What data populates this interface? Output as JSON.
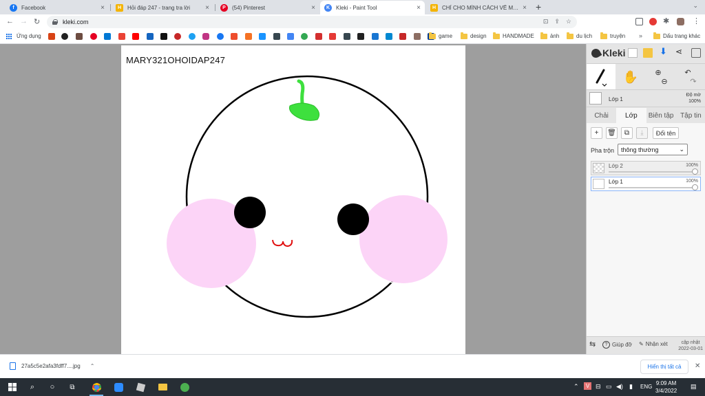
{
  "browser": {
    "tabs": [
      {
        "title": "Facebook",
        "icon_color": "#1877f2",
        "icon_glyph": "f",
        "active": false
      },
      {
        "title": "Hỏi đáp 247 - trang tra lời",
        "icon_color": "#f4b400",
        "icon_glyph": "H",
        "active": false
      },
      {
        "title": "(54) Pinterest",
        "icon_color": "#e60023",
        "icon_glyph": "P",
        "active": false
      },
      {
        "title": "Kleki - Paint Tool",
        "icon_color": "#4285f4",
        "icon_glyph": "K",
        "active": true
      },
      {
        "title": "CHỈ CHO MÌNH CÁCH VẼ MẦM Đ",
        "icon_color": "#f4b400",
        "icon_glyph": "H",
        "active": false
      }
    ],
    "new_tab_glyph": "+",
    "address": "kleki.com"
  },
  "bookmarks": {
    "apps_label": "Ứng dụng",
    "folders": [
      "game",
      "design",
      "HANDMADE",
      "ảnh",
      "du lịch",
      "truyện"
    ],
    "more_glyph": "»",
    "other_label": "Dấu trang khác"
  },
  "canvas": {
    "text": "MARY321OHOIDAP247"
  },
  "kleki": {
    "logo": "Kleki",
    "top_layer_name": "Lớp 1",
    "top_opacity_label": "Độ mờ",
    "top_opacity_value": "100%",
    "tabs": [
      "Chải",
      "Lớp",
      "Biên tập",
      "Tập tin"
    ],
    "active_tab": "Lớp",
    "rename_label": "Đổi tên",
    "blend_label": "Pha trộn",
    "blend_value": "thông thường",
    "layers": [
      {
        "name": "Lớp 2",
        "opacity": "100%",
        "selected": false
      },
      {
        "name": "Lớp 1",
        "opacity": "100%",
        "selected": true
      }
    ],
    "footer": {
      "help_label": "Giúp đỡ",
      "feedback_label": "Nhận xét",
      "update_label": "cập nhật",
      "update_date": "2022-03-01"
    }
  },
  "download": {
    "filename": "27a5c5e2afa3fdff7....jpg",
    "show_all": "Hiển thị tất cả"
  },
  "taskbar": {
    "language": "ENG",
    "time": "9:09 AM",
    "date": "3/4/2022"
  },
  "colors": {
    "cheek": "#fcd4f7",
    "sprout": "#3ee03e",
    "mouth": "#e01010"
  }
}
